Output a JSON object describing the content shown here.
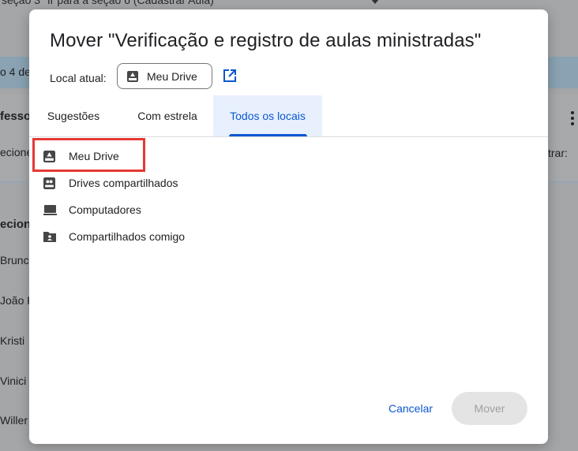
{
  "background": {
    "top_text": "seção 3 \"Ir para a seção 6 (Cadastrar Aula)\"",
    "band_text": "o 4 de",
    "card_heading": "fesso",
    "card_sub_left": "ecione",
    "card_sub_right": "trar:",
    "section_heading": "ecion",
    "names": [
      "Brunc",
      "João F",
      "Kristi",
      "Vinici",
      "Willer"
    ]
  },
  "dialog": {
    "title": "Mover \"Verificação e registro de aulas ministradas\"",
    "location_label": "Local atual:",
    "location_value": "Meu Drive",
    "tabs": [
      {
        "label": "Sugestões",
        "active": false
      },
      {
        "label": "Com estrela",
        "active": false
      },
      {
        "label": "Todos os locais",
        "active": true
      }
    ],
    "items": [
      {
        "label": "Meu Drive",
        "icon": "drive-icon"
      },
      {
        "label": "Drives compartilhados",
        "icon": "shared-drives-icon"
      },
      {
        "label": "Computadores",
        "icon": "computer-icon"
      },
      {
        "label": "Compartilhados comigo",
        "icon": "shared-folder-icon"
      }
    ],
    "cancel_label": "Cancelar",
    "move_label": "Mover"
  },
  "colors": {
    "accent": "#0b57d0",
    "highlight": "#e53935",
    "active_tab_bg": "#e8f0fe"
  }
}
